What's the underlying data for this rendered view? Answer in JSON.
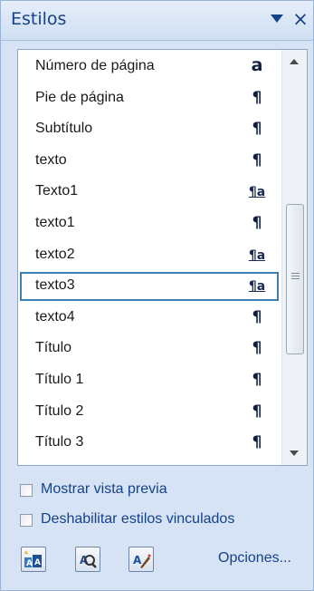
{
  "pane": {
    "title": "Estilos",
    "menu_icon": "dropdown-arrow-icon",
    "close_label": "×"
  },
  "styles": {
    "items": [
      {
        "name": "Número de página",
        "type_symbol": "a",
        "type": "character"
      },
      {
        "name": "Pie de página",
        "type_symbol": "¶",
        "type": "paragraph"
      },
      {
        "name": "Subtítulo",
        "type_symbol": "¶",
        "type": "paragraph"
      },
      {
        "name": "texto",
        "type_symbol": "¶",
        "type": "paragraph"
      },
      {
        "name": "Texto1",
        "type_symbol": "¶a",
        "type": "linked"
      },
      {
        "name": "texto1",
        "type_symbol": "¶",
        "type": "paragraph"
      },
      {
        "name": "texto2",
        "type_symbol": "¶a",
        "type": "linked"
      },
      {
        "name": "texto3",
        "type_symbol": "¶a",
        "type": "linked",
        "selected": true
      },
      {
        "name": "texto4",
        "type_symbol": "¶",
        "type": "paragraph"
      },
      {
        "name": "Título",
        "type_symbol": "¶",
        "type": "paragraph"
      },
      {
        "name": "Título 1",
        "type_symbol": "¶",
        "type": "paragraph"
      },
      {
        "name": "Título 2",
        "type_symbol": "¶",
        "type": "paragraph"
      },
      {
        "name": "Título 3",
        "type_symbol": "¶",
        "type": "paragraph"
      }
    ],
    "scrollbar": {
      "position": 0.55
    }
  },
  "options": {
    "show_preview": {
      "label": "Mostrar vista previa",
      "checked": false
    },
    "disable_linked": {
      "label": "Deshabilitar estilos vinculados",
      "checked": false
    }
  },
  "toolbar": {
    "buttons": [
      {
        "icon": "new-style-icon"
      },
      {
        "icon": "style-inspector-icon"
      },
      {
        "icon": "manage-styles-icon"
      }
    ],
    "options_link": "Opciones..."
  },
  "colors": {
    "pane_background": "#d5e3f5",
    "title_text": "#15428b",
    "selection_border": "#3c7fb1"
  }
}
